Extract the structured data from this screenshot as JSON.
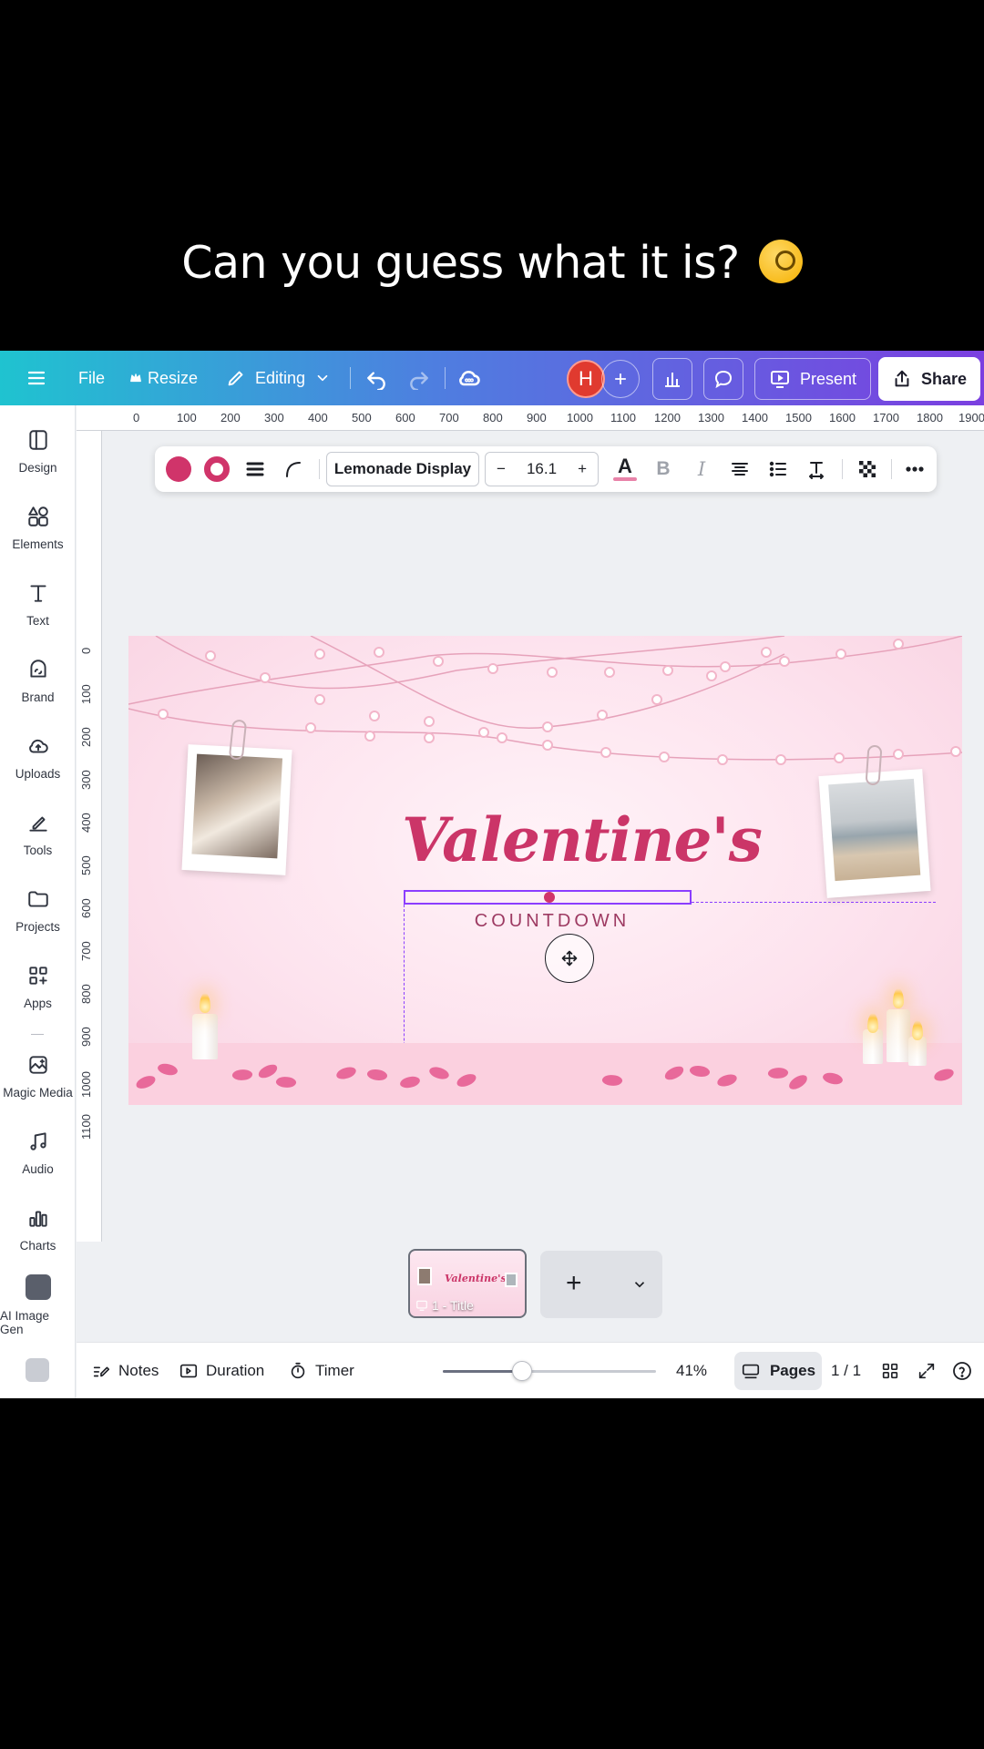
{
  "caption": "Can you guess what it is?",
  "caption_emoji": "monocle-face-emoji",
  "topbar": {
    "menu_icon": "hamburger-icon",
    "file": "File",
    "resize": "Resize",
    "mode": "Editing",
    "avatar_initial": "H",
    "present": "Present",
    "share": "Share"
  },
  "sidebar": {
    "items": [
      {
        "label": "Design",
        "icon": "design-icon"
      },
      {
        "label": "Elements",
        "icon": "elements-icon"
      },
      {
        "label": "Text",
        "icon": "text-icon"
      },
      {
        "label": "Brand",
        "icon": "brand-icon"
      },
      {
        "label": "Uploads",
        "icon": "uploads-icon"
      },
      {
        "label": "Tools",
        "icon": "tools-icon"
      },
      {
        "label": "Projects",
        "icon": "projects-icon"
      },
      {
        "label": "Apps",
        "icon": "apps-icon"
      },
      {
        "label": "Magic Media",
        "icon": "magic-media-icon"
      },
      {
        "label": "Audio",
        "icon": "audio-icon"
      },
      {
        "label": "Charts",
        "icon": "charts-icon"
      },
      {
        "label": "AI Image Gen",
        "icon": "ai-image-gen-icon"
      }
    ]
  },
  "ruler": {
    "top": [
      "0",
      "100",
      "200",
      "300",
      "400",
      "500",
      "600",
      "700",
      "800",
      "900",
      "1000",
      "1100",
      "1200",
      "1300",
      "1400",
      "1500",
      "1600",
      "1700",
      "1800",
      "1900"
    ],
    "left": [
      "0",
      "100",
      "200",
      "300",
      "400",
      "500",
      "600",
      "700",
      "800",
      "900",
      "1000",
      "1100"
    ]
  },
  "text_toolbar": {
    "font": "Lemonade Display",
    "font_size": "16.1",
    "minus": "−",
    "plus": "+",
    "text_color": "#d0346a"
  },
  "design": {
    "title": "Valentine's",
    "subtitle": "COUNTDOWN",
    "accent": "#cb3568",
    "background": "#fde3ee"
  },
  "pages": {
    "thumb_label": "1 - Title",
    "add": "+"
  },
  "bottombar": {
    "notes": "Notes",
    "duration": "Duration",
    "timer": "Timer",
    "zoom": "41%",
    "zoom_value": 0.37,
    "pages_label": "Pages",
    "page_count": "1 / 1"
  }
}
